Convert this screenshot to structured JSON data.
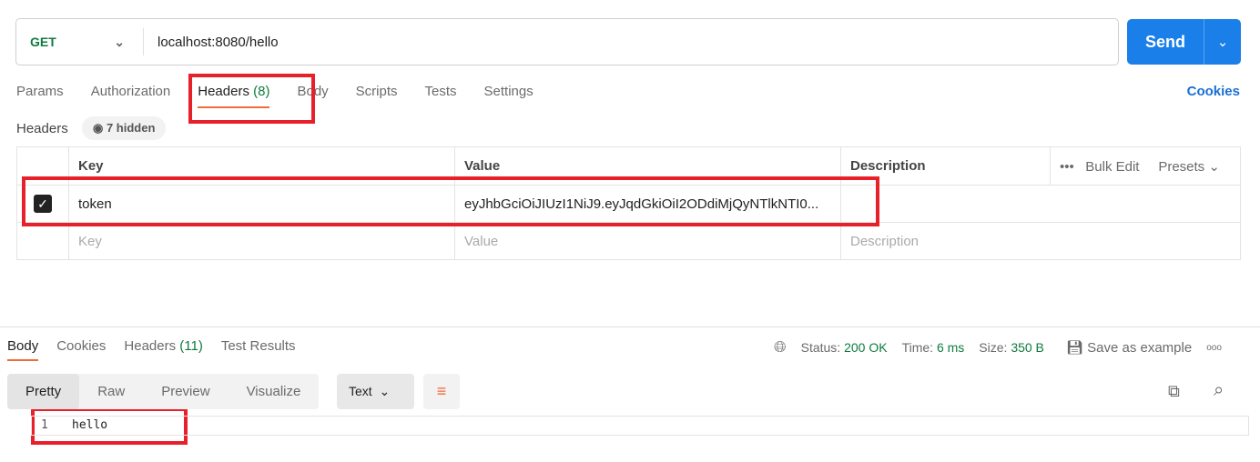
{
  "request": {
    "method": "GET",
    "url": "localhost:8080/hello",
    "send_label": "Send"
  },
  "tabs": [
    {
      "label": "Params"
    },
    {
      "label": "Authorization"
    },
    {
      "label": "Headers",
      "count": "(8)"
    },
    {
      "label": "Body"
    },
    {
      "label": "Scripts"
    },
    {
      "label": "Tests"
    },
    {
      "label": "Settings"
    }
  ],
  "cookies_label": "Cookies",
  "headers": {
    "label": "Headers",
    "hidden": "7 hidden",
    "columns": {
      "key": "Key",
      "value": "Value",
      "description": "Description"
    },
    "bulk_edit": "Bulk Edit",
    "presets": "Presets",
    "rows": [
      {
        "checked": true,
        "key": "token",
        "value": "eyJhbGciOiJIUzI1NiJ9.eyJqdGkiOiI2ODdiMjQyNTlkNTI0..."
      }
    ],
    "placeholders": {
      "key": "Key",
      "value": "Value",
      "description": "Description"
    }
  },
  "response": {
    "tabs": [
      {
        "label": "Body"
      },
      {
        "label": "Cookies"
      },
      {
        "label": "Headers",
        "count": "(11)"
      },
      {
        "label": "Test Results"
      }
    ],
    "status_label": "Status:",
    "status": "200 OK",
    "time_label": "Time:",
    "time": "6 ms",
    "size_label": "Size:",
    "size": "350 B",
    "save_example": "Save as example",
    "views": [
      "Pretty",
      "Raw",
      "Preview",
      "Visualize"
    ],
    "format": "Text",
    "lines": [
      {
        "n": "1",
        "text": "hello"
      }
    ]
  },
  "colors": {
    "accent": "#f26b3a",
    "send": "#1a7fe8",
    "green": "#0f7b3f",
    "highlight": "#e8202a"
  }
}
